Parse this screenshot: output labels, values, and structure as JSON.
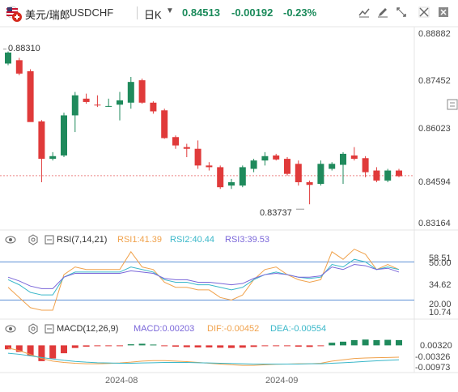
{
  "header": {
    "symbol_name": "美元/瑞郎",
    "symbol_code": "USDCHF",
    "interval": "日K",
    "last_price": "0.84513",
    "change": "-0.00192",
    "change_pct": "-0.23%",
    "icons": [
      "flag-icon",
      "chevron-down-icon",
      "line-chart-icon",
      "pencil-icon",
      "fullscreen-icon",
      "close-icon"
    ]
  },
  "price_axis": {
    "labels": [
      "0.88882",
      "0.87452",
      "0.86023",
      "0.84594",
      "0.83164"
    ],
    "current_price_label": "0.84594"
  },
  "annotations": {
    "high": "0.88310",
    "low": "0.83737"
  },
  "rsi": {
    "title": "RSI(7,14,21)",
    "rsi1": "RSI1:41.39",
    "rsi2": "RSI2:40.44",
    "rsi3": "RSI3:39.53",
    "axis": [
      "58.51",
      "50.00",
      "34.62",
      "20.00",
      "10.74"
    ]
  },
  "macd": {
    "title": "MACD(12,26,9)",
    "macd": "MACD:0.00203",
    "dif": "DIF:-0.00452",
    "dea": "DEA:-0.00554",
    "axis": [
      "0.00320",
      "-0.00326",
      "-0.00973"
    ]
  },
  "time_axis": [
    "2024-08",
    "2024-09"
  ],
  "colors": {
    "up": "#1f8a5c",
    "down": "#e03a3a",
    "rsi1": "#f0a24c",
    "rsi2": "#39b7c9",
    "rsi3": "#7a66d9",
    "dif": "#f0a24c",
    "dea": "#39b7c9"
  },
  "chart_data": {
    "type": "candlestick",
    "title": "",
    "candles": [
      {
        "o": 0.8795,
        "h": 0.8831,
        "l": 0.879,
        "c": 0.8828
      },
      {
        "o": 0.8805,
        "h": 0.8812,
        "l": 0.876,
        "c": 0.8765
      },
      {
        "o": 0.8772,
        "h": 0.8778,
        "l": 0.8625,
        "c": 0.862
      },
      {
        "o": 0.8622,
        "h": 0.8626,
        "l": 0.844,
        "c": 0.851
      },
      {
        "o": 0.851,
        "h": 0.853,
        "l": 0.8505,
        "c": 0.8518
      },
      {
        "o": 0.852,
        "h": 0.8648,
        "l": 0.8515,
        "c": 0.864
      },
      {
        "o": 0.864,
        "h": 0.871,
        "l": 0.859,
        "c": 0.87
      },
      {
        "o": 0.869,
        "h": 0.8705,
        "l": 0.8675,
        "c": 0.868
      },
      {
        "o": 0.8672,
        "h": 0.87,
        "l": 0.8665,
        "c": 0.867
      },
      {
        "o": 0.8668,
        "h": 0.869,
        "l": 0.8665,
        "c": 0.8668
      },
      {
        "o": 0.8672,
        "h": 0.871,
        "l": 0.8625,
        "c": 0.8685
      },
      {
        "o": 0.8678,
        "h": 0.8755,
        "l": 0.866,
        "c": 0.874
      },
      {
        "o": 0.8745,
        "h": 0.875,
        "l": 0.8675,
        "c": 0.8678
      },
      {
        "o": 0.8678,
        "h": 0.8682,
        "l": 0.8645,
        "c": 0.8652
      },
      {
        "o": 0.8655,
        "h": 0.866,
        "l": 0.857,
        "c": 0.8572
      },
      {
        "o": 0.8575,
        "h": 0.858,
        "l": 0.854,
        "c": 0.855
      },
      {
        "o": 0.8545,
        "h": 0.8555,
        "l": 0.8515,
        "c": 0.854
      },
      {
        "o": 0.854,
        "h": 0.8565,
        "l": 0.848,
        "c": 0.849
      },
      {
        "o": 0.849,
        "h": 0.85,
        "l": 0.8475,
        "c": 0.8485
      },
      {
        "o": 0.8485,
        "h": 0.849,
        "l": 0.842,
        "c": 0.8425
      },
      {
        "o": 0.843,
        "h": 0.845,
        "l": 0.842,
        "c": 0.844
      },
      {
        "o": 0.843,
        "h": 0.849,
        "l": 0.8425,
        "c": 0.8485
      },
      {
        "o": 0.848,
        "h": 0.851,
        "l": 0.847,
        "c": 0.8505
      },
      {
        "o": 0.8505,
        "h": 0.853,
        "l": 0.849,
        "c": 0.8518
      },
      {
        "o": 0.852,
        "h": 0.8525,
        "l": 0.8505,
        "c": 0.8508
      },
      {
        "o": 0.851,
        "h": 0.8515,
        "l": 0.846,
        "c": 0.8465
      },
      {
        "o": 0.8495,
        "h": 0.8505,
        "l": 0.843,
        "c": 0.844
      },
      {
        "o": 0.844,
        "h": 0.8445,
        "l": 0.8374,
        "c": 0.8432
      },
      {
        "o": 0.8435,
        "h": 0.8505,
        "l": 0.843,
        "c": 0.8495
      },
      {
        "o": 0.848,
        "h": 0.85,
        "l": 0.8475,
        "c": 0.8495
      },
      {
        "o": 0.8492,
        "h": 0.853,
        "l": 0.8435,
        "c": 0.8525
      },
      {
        "o": 0.852,
        "h": 0.8545,
        "l": 0.8505,
        "c": 0.851
      },
      {
        "o": 0.8512,
        "h": 0.8518,
        "l": 0.8455,
        "c": 0.847
      },
      {
        "o": 0.8475,
        "h": 0.8485,
        "l": 0.844,
        "c": 0.8445
      },
      {
        "o": 0.8445,
        "h": 0.848,
        "l": 0.844,
        "c": 0.8475
      },
      {
        "o": 0.8475,
        "h": 0.848,
        "l": 0.8455,
        "c": 0.8458
      }
    ],
    "price_range": [
      0.83164,
      0.88882
    ],
    "rsi_series": {
      "rsi1": [
        30,
        22,
        14,
        12,
        12,
        40,
        46,
        44,
        44,
        44,
        44,
        58,
        46,
        44,
        34,
        30,
        30,
        28,
        28,
        22,
        20,
        24,
        36,
        44,
        46,
        40,
        36,
        34,
        36,
        58,
        52,
        60,
        56,
        44,
        48,
        44
      ],
      "rsi2": [
        36,
        32,
        26,
        24,
        24,
        38,
        42,
        42,
        42,
        42,
        42,
        46,
        44,
        42,
        36,
        34,
        34,
        32,
        32,
        30,
        28,
        30,
        36,
        40,
        42,
        40,
        38,
        37,
        38,
        48,
        46,
        52,
        50,
        44,
        46,
        44
      ],
      "rsi3": [
        38,
        35,
        31,
        29,
        29,
        38,
        41,
        41,
        41,
        41,
        41,
        43,
        42,
        41,
        37,
        36,
        36,
        34,
        34,
        33,
        32,
        33,
        37,
        40,
        41,
        40,
        38,
        38,
        39,
        46,
        44,
        48,
        47,
        44,
        45,
        42
      ]
    },
    "macd_series": {
      "hist": [
        -0.0015,
        -0.0025,
        -0.004,
        -0.006,
        -0.005,
        -0.003,
        -0.001,
        -0.0005,
        -0.0003,
        -0.0002,
        -0.0001,
        0.0004,
        0.0006,
        0.0003,
        -0.0002,
        -0.0005,
        -0.0007,
        -0.0008,
        -0.0008,
        -0.0009,
        -0.001,
        -0.0009,
        -0.0006,
        -0.0003,
        -0.0001,
        -0.0003,
        -0.0005,
        -0.0006,
        -0.0003,
        0.001,
        0.0014,
        0.002,
        0.0022,
        0.002,
        0.0021,
        0.002
      ],
      "dif": [
        -0.001,
        -0.002,
        -0.0035,
        -0.005,
        -0.006,
        -0.0065,
        -0.0068,
        -0.007,
        -0.007,
        -0.0069,
        -0.0067,
        -0.0064,
        -0.006,
        -0.0058,
        -0.0058,
        -0.006,
        -0.0062,
        -0.0065,
        -0.0068,
        -0.0071,
        -0.0074,
        -0.0076,
        -0.0076,
        -0.0074,
        -0.0072,
        -0.0071,
        -0.007,
        -0.007,
        -0.0068,
        -0.006,
        -0.0055,
        -0.005,
        -0.0048,
        -0.0047,
        -0.0046,
        -0.0045
      ],
      "dea": [
        -0.003,
        -0.0034,
        -0.004,
        -0.0046,
        -0.0052,
        -0.0057,
        -0.0061,
        -0.0064,
        -0.0066,
        -0.0067,
        -0.0068,
        -0.0068,
        -0.0067,
        -0.0066,
        -0.0065,
        -0.0065,
        -0.0065,
        -0.0066,
        -0.0067,
        -0.0068,
        -0.0069,
        -0.007,
        -0.0071,
        -0.0071,
        -0.0071,
        -0.0071,
        -0.0071,
        -0.007,
        -0.007,
        -0.0068,
        -0.0066,
        -0.0064,
        -0.0061,
        -0.0059,
        -0.0057,
        -0.0055
      ]
    },
    "rsi_range": [
      10.74,
      58.51
    ],
    "macd_range": [
      -0.00973,
      0.0032
    ]
  }
}
